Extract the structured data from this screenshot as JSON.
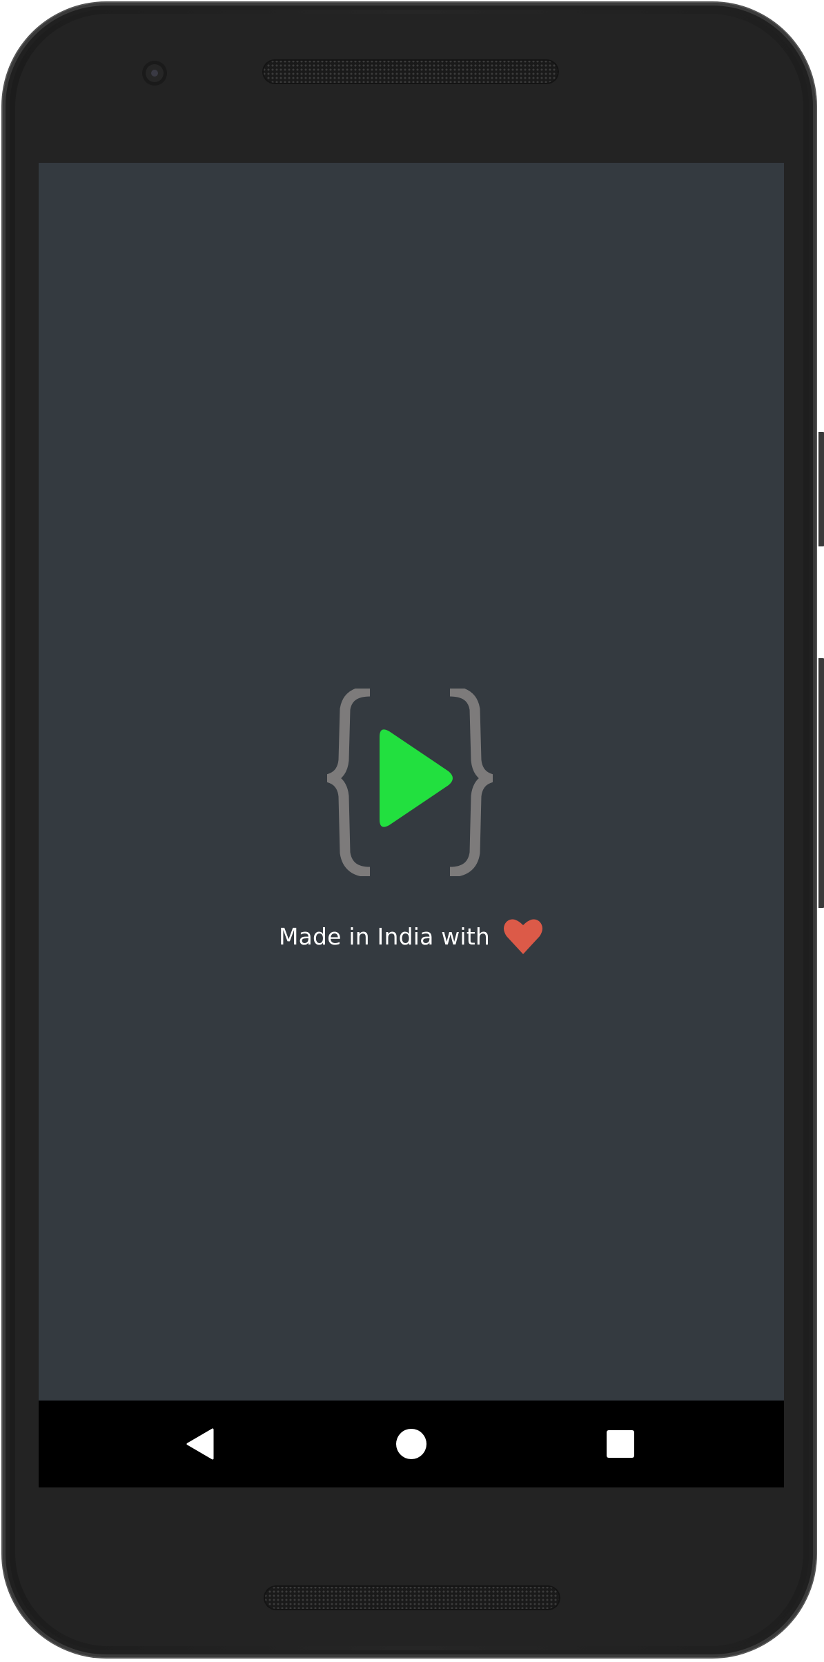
{
  "app": {
    "tagline_text": "Made in India with",
    "logo_icon": "braces-play-logo",
    "heart_icon": "heart-icon"
  },
  "colors": {
    "screen_background": "#343a40",
    "brace_color": "#7d7b7b",
    "play_color": "#22e03f",
    "heart_color": "#dc5a48",
    "tagline_color": "#ffffff",
    "navbar_background": "#000000"
  },
  "navbar": {
    "back_icon": "back-triangle-icon",
    "home_icon": "home-circle-icon",
    "recents_icon": "recents-square-icon"
  }
}
